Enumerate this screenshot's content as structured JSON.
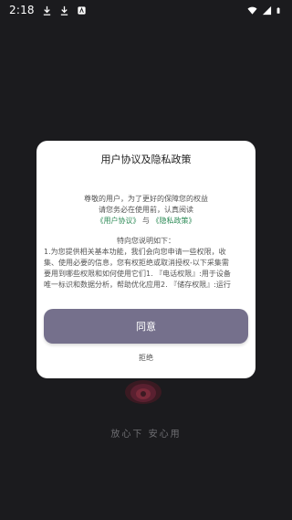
{
  "status_bar": {
    "time": "2:18",
    "icons": [
      "download-icon",
      "download-icon",
      "app-notification-icon",
      "wifi-icon",
      "signal-icon",
      "battery-icon"
    ]
  },
  "background": {
    "slogan": "放心下 安心用"
  },
  "dialog": {
    "title": "用户协议及隐私政策",
    "intro_line1": "尊敬的用户，为了更好的保障您的权益",
    "intro_line2": "请您务必在使用前，认真阅读",
    "user_agreement_link": "《用户协议》",
    "and_text": "与",
    "privacy_policy_link": "《隐私政策》",
    "notice_heading": "特向您说明如下：",
    "body_line1": "1.为您提供相关基本功能，我们会向您申请一些权限，收",
    "body_line2": "集、使用必要的信息，您有权拒绝或取消授权-以下采集需",
    "body_line3": "要用到哪些权限和如何使用它们1. 『电话权限』:用于设备",
    "body_line4": "唯一标识和数据分析，帮助优化应用2. 『储存权限』:运行",
    "agree_label": "同意",
    "refuse_label": "拒绝",
    "accent_color": "#75708c",
    "link_color": "#2e8b57"
  }
}
